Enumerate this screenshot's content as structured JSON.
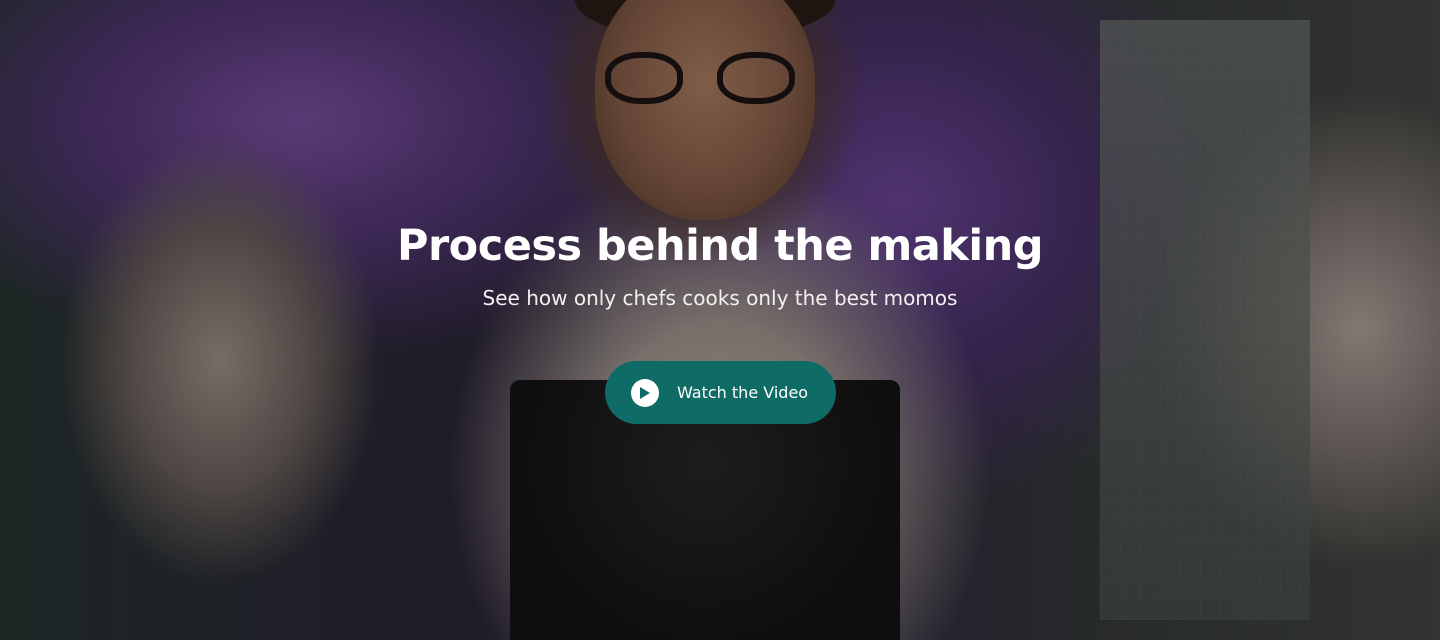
{
  "hero": {
    "title": "Process behind the making",
    "subtitle": "See how only chefs cooks only the best momos",
    "cta": {
      "label": "Watch the Video",
      "icon": "play-icon",
      "bg_color": "#0f6b66"
    },
    "background": {
      "description_icon": "chef-photo",
      "overlay_color": "#0a0808"
    }
  }
}
